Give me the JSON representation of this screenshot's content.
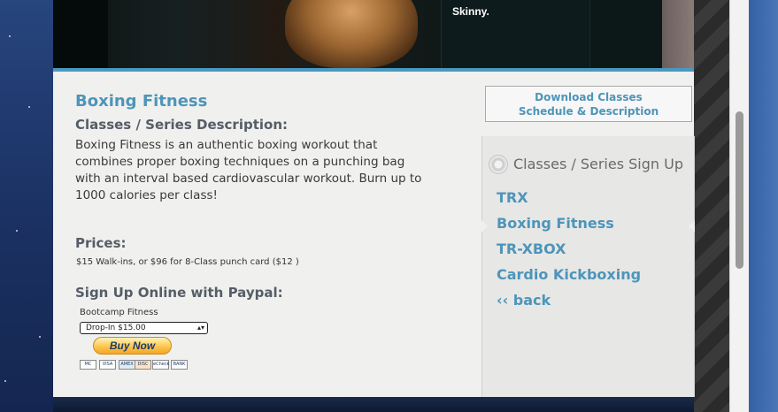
{
  "hero": {
    "panel_text": "Skinny."
  },
  "main": {
    "title": "Boxing Fitness",
    "description_heading": "Classes / Series Description:",
    "description": "Boxing Fitness is an authentic boxing workout that combines proper boxing techniques on a punching bag with an interval based cardiovascular workout. Burn up to 1000 calories per class!",
    "prices_heading": "Prices:",
    "prices_text": "$15 Walk-ins, or $96 for 8-Class punch card ($12 )",
    "signup_heading": "Sign Up Online with Paypal:",
    "paypal_item_label": "Bootcamp Fitness",
    "paypal_select_value": "Drop-In $15.00",
    "buy_button_label": "Buy Now",
    "cards": [
      "MC",
      "VISA",
      "AMEX",
      "DISC",
      "eCheck",
      "BANK"
    ]
  },
  "sidebar": {
    "download_line1": "Download Classes",
    "download_line2": "Schedule & Description",
    "header": "Classes / Series Sign Up",
    "links": [
      {
        "label": "TRX"
      },
      {
        "label": "Boxing Fitness"
      },
      {
        "label": "TR-XBOX"
      },
      {
        "label": "Cardio Kickboxing"
      },
      {
        "label": "‹‹ back"
      }
    ]
  },
  "colors": {
    "accent": "#4d95b9",
    "heading": "#555d66",
    "bar": "#4a98bf"
  }
}
